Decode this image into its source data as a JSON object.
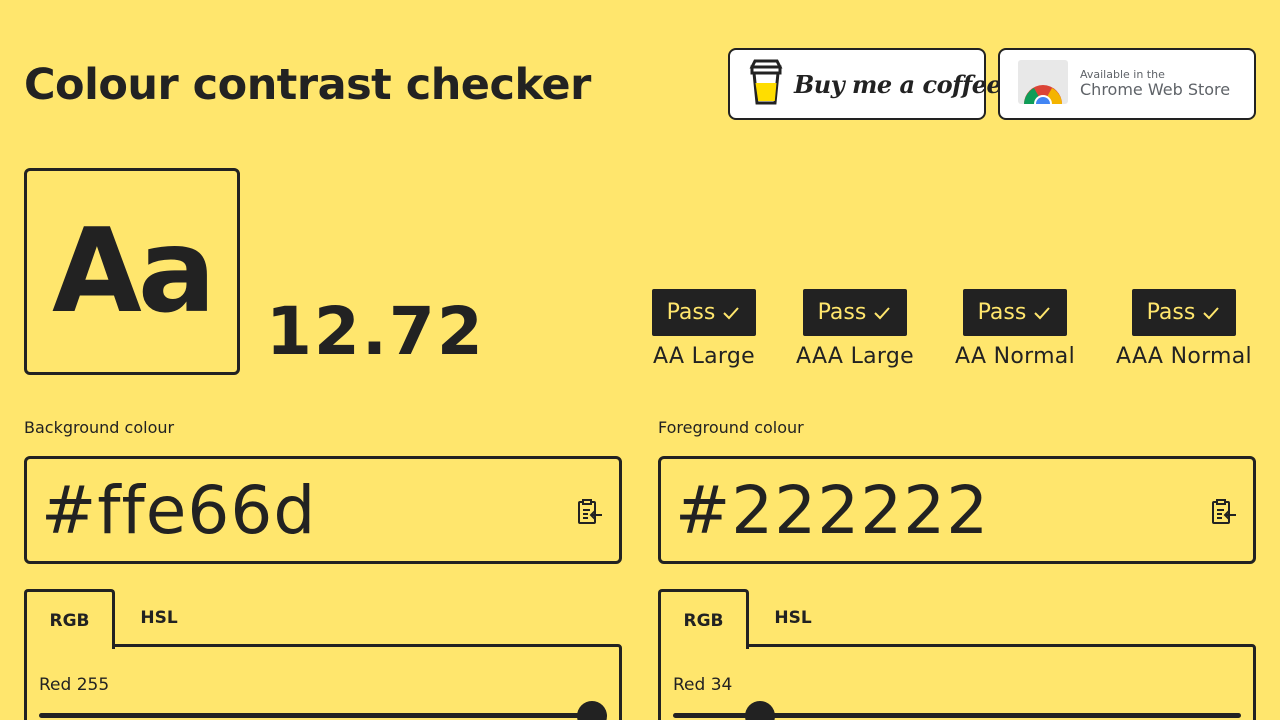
{
  "header": {
    "title": "Colour contrast checker",
    "coffee_label": "Buy me a coffee",
    "chrome_small": "Available in the",
    "chrome_big": "Chrome Web Store"
  },
  "preview": {
    "sample": "Aa",
    "ratio": "12.72"
  },
  "results": [
    {
      "status": "Pass",
      "label": "AA Large"
    },
    {
      "status": "Pass",
      "label": "AAA Large"
    },
    {
      "status": "Pass",
      "label": "AA Normal"
    },
    {
      "status": "Pass",
      "label": "AAA Normal"
    }
  ],
  "background": {
    "label": "Background colour",
    "value": "#ffe66d",
    "tabs": [
      "RGB",
      "HSL"
    ],
    "slider_label": "Red 255",
    "slider_fraction": 1.0
  },
  "foreground": {
    "label": "Foreground colour",
    "value": "#222222",
    "tabs": [
      "RGB",
      "HSL"
    ],
    "slider_label": "Red 34",
    "slider_fraction": 0.133
  },
  "colors": {
    "background": "#ffe66d",
    "foreground": "#222222"
  },
  "icons": {
    "check": "check-icon",
    "paste": "paste-clipboard-icon",
    "cup": "coffee-cup-icon",
    "chrome": "chrome-logo-icon"
  }
}
